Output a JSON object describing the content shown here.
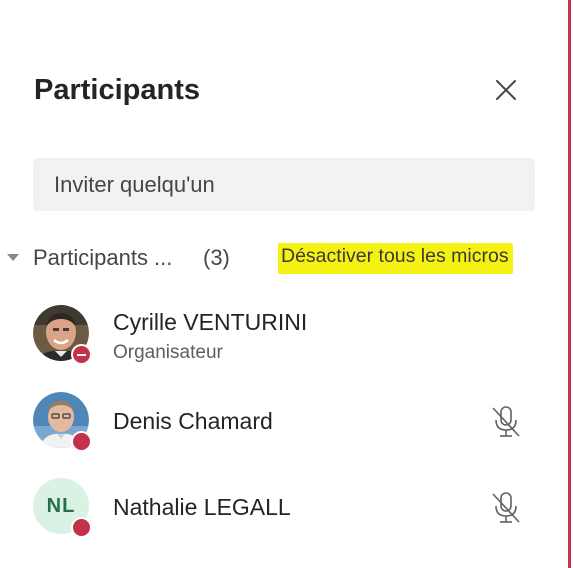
{
  "panel": {
    "title": "Participants",
    "invite_placeholder": "Inviter quelqu'un"
  },
  "section": {
    "label": "Participants ...",
    "count": "(3)",
    "mute_all_label": "Désactiver tous les micros",
    "highlight_color": "#f5f213"
  },
  "participants": [
    {
      "name": "Cyrille VENTURINI",
      "role": "Organisateur",
      "avatar": "photo",
      "presence": "do-not-disturb",
      "mic": "none"
    },
    {
      "name": "Denis Chamard",
      "role": "",
      "avatar": "photo",
      "presence": "busy",
      "mic": "muted-mic-icon"
    },
    {
      "name": "Nathalie LEGALL",
      "role": "",
      "avatar_initials": "NL",
      "presence": "busy",
      "mic": "muted-mic-icon"
    }
  ],
  "colors": {
    "presence_busy": "#c4314b",
    "initials_bg": "#daf2e4",
    "initials_fg": "#24704a",
    "invite_bg": "#f3f2f1"
  }
}
